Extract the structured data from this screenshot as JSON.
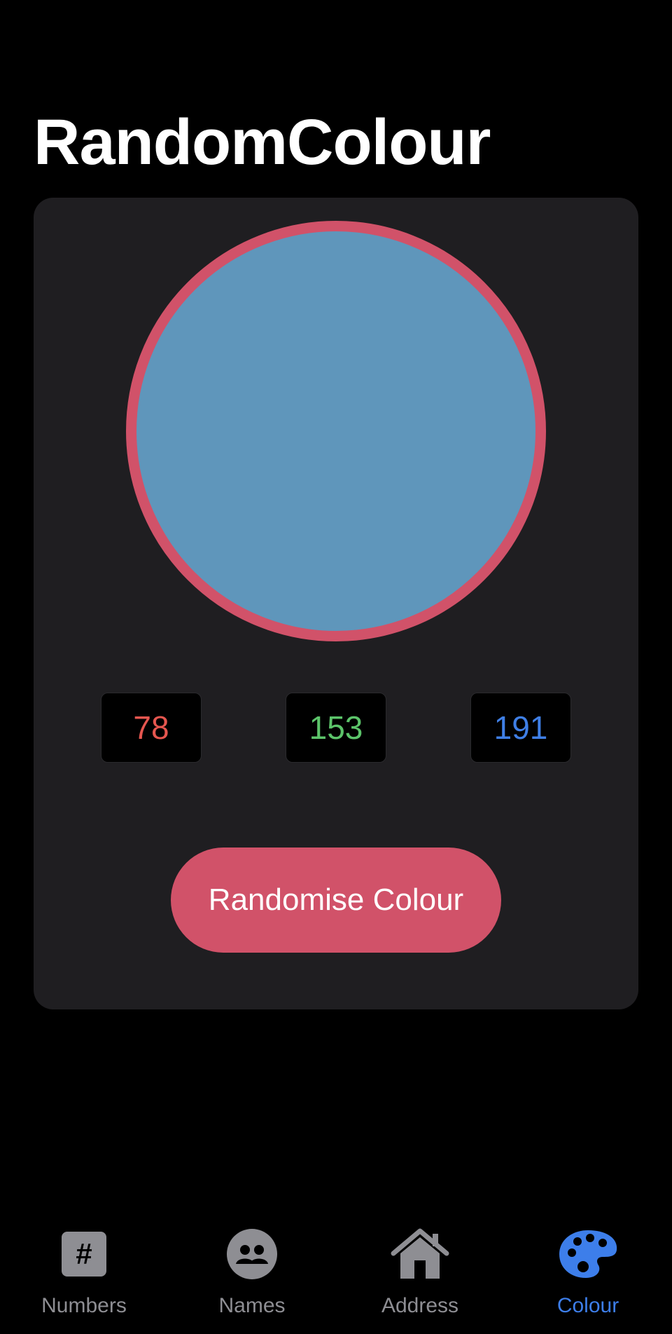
{
  "header": {
    "title": "RandomColour"
  },
  "colour": {
    "swatch_fill": "#5f96bb",
    "swatch_border": "#d15269",
    "red": "78",
    "green": "153",
    "blue": "191",
    "red_color": "#e5564f",
    "green_color": "#5cc46a",
    "blue_color": "#3f7fe6"
  },
  "actions": {
    "randomise_label": "Randomise Colour",
    "randomise_color": "#d15269"
  },
  "tabs": [
    {
      "label": "Numbers",
      "icon": "hash-icon",
      "active": false
    },
    {
      "label": "Names",
      "icon": "people-icon",
      "active": false
    },
    {
      "label": "Address",
      "icon": "house-icon",
      "active": false
    },
    {
      "label": "Colour",
      "icon": "palette-icon",
      "active": true
    }
  ],
  "theme": {
    "inactive_tab": "#8e8e93",
    "active_tab": "#3d7eea"
  }
}
